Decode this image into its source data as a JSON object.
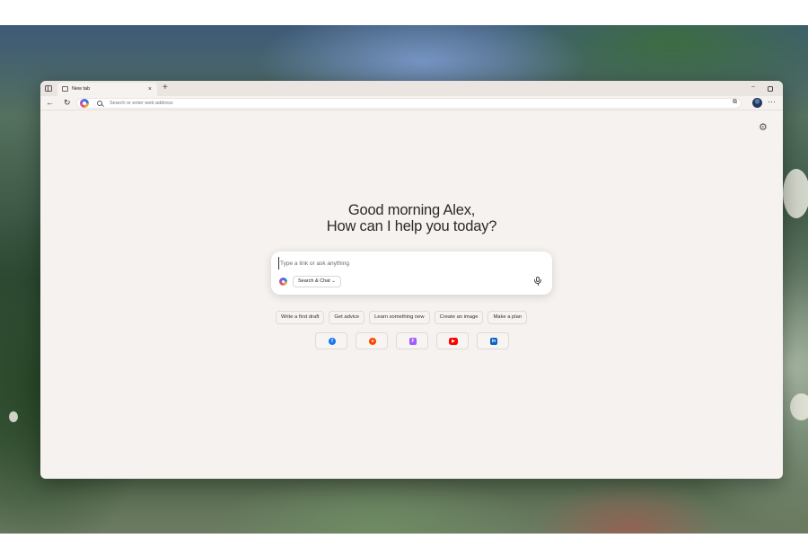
{
  "browser": {
    "tab": {
      "title": "New tab",
      "close_glyph": "×"
    },
    "new_tab_glyph": "+",
    "window_controls": {
      "minimize_glyph": "–"
    },
    "toolbar": {
      "back_glyph": "←",
      "reload_glyph": "↻",
      "address_placeholder": "Search or enter web address",
      "extensions_glyph": "⧉",
      "more_glyph": "···"
    }
  },
  "page": {
    "settings_glyph": "⚙",
    "greeting": {
      "line1": "Good morning Alex,",
      "line2": "How can I help you today?"
    },
    "chat": {
      "placeholder": "Type a link or ask anything",
      "mode_label": "Search & Chat ⌄"
    },
    "suggestions": [
      "Write a first draft",
      "Get advice",
      "Learn something new",
      "Create an image",
      "Make a plan"
    ],
    "shortcuts": [
      {
        "name": "facebook",
        "glyph": "f",
        "color": "#1877f2"
      },
      {
        "name": "reddit",
        "glyph": "●",
        "color": "#ff4500"
      },
      {
        "name": "figma",
        "glyph": "F",
        "color": "#a259ff"
      },
      {
        "name": "youtube",
        "glyph": "▶",
        "color": "#ff0000"
      },
      {
        "name": "linkedin",
        "glyph": "in",
        "color": "#0a66c2"
      }
    ]
  }
}
